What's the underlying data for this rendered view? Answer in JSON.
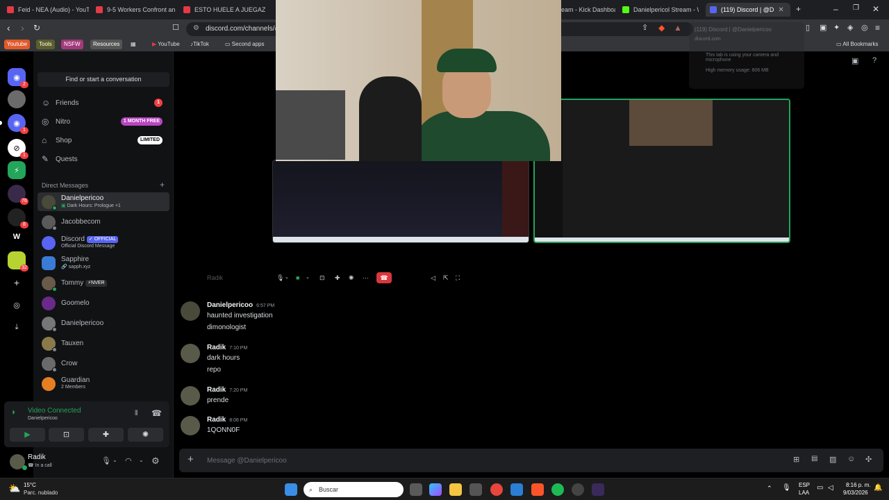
{
  "browser": {
    "tabs": [
      {
        "label": "Feid - NEA (Audio) - YouTu",
        "color": "#e63946"
      },
      {
        "label": "9-5 Workers Confront an",
        "color": "#e63946"
      },
      {
        "label": "ESTO HUELE A JUEGAZO !!",
        "color": "#e63946"
      },
      {
        "label": "eam - Kick Dashboa",
        "color": "#53fc18"
      },
      {
        "label": "Danielpericol Stream - Wa",
        "color": "#53fc18"
      },
      {
        "label": "(119) Discord | @D",
        "color": "#5865f2"
      }
    ],
    "url": "discord.com/channels/@",
    "bookmarks": [
      "Youtube",
      "Tools",
      "NSFW",
      "Resources",
      "YouTube",
      "TikTok",
      "Second apps",
      "All Bookmarks"
    ],
    "tooltip": {
      "title": "(119) Discord | @Danielpericoo",
      "domain": "discord.com",
      "camera": "This tab is using your camera and microphone",
      "memory": "High memory usage: 806 MB"
    }
  },
  "guilds": [
    {
      "icon": "discord-home",
      "badge": "2"
    },
    {
      "icon": "avatar",
      "badge": ""
    },
    {
      "icon": "discord",
      "badge": "1"
    },
    {
      "icon": "server",
      "badge": "1"
    },
    {
      "icon": "server",
      "badge": ""
    },
    {
      "icon": "server",
      "badge": "76"
    },
    {
      "icon": "server",
      "badge": "8"
    },
    {
      "icon": "W",
      "badge": ""
    },
    {
      "icon": "server",
      "badge": "32"
    }
  ],
  "sidebar": {
    "search_label": "Find or start a conversation",
    "nav": [
      {
        "label": "Friends",
        "badge": "1"
      },
      {
        "label": "Nitro",
        "badge": "1 MONTH FREE"
      },
      {
        "label": "Shop",
        "badge": "LIMITED"
      },
      {
        "label": "Quests",
        "badge": ""
      }
    ],
    "dm_header": "Direct Messages",
    "dms": [
      {
        "name": "Danielpericoo",
        "sub": "Dark Hours: Prologue +1"
      },
      {
        "name": "Jacobbecom",
        "sub": ""
      },
      {
        "name": "Discord",
        "tag": "OFFICIAL",
        "sub": "Official Discord Message"
      },
      {
        "name": "Sapphire",
        "sub": "sapph.xyz"
      },
      {
        "name": "Tommy",
        "tag": "NVER",
        "sub": ""
      },
      {
        "name": "Goomelo",
        "sub": ""
      },
      {
        "name": "Danielpericoo",
        "sub": ""
      },
      {
        "name": "Tauxen",
        "sub": ""
      },
      {
        "name": "Crow",
        "sub": ""
      },
      {
        "name": "Guardian",
        "sub": "2 Members"
      }
    ]
  },
  "voice": {
    "status": "Video Connected",
    "channel": "Danielpericoo"
  },
  "user": {
    "name": "Radik",
    "status": "In a call"
  },
  "call": {
    "name_label": "Radik"
  },
  "messages": [
    {
      "author": "Danielpericoo",
      "time": "6:57 PM",
      "lines": [
        "haunted investigation",
        "dimonologist"
      ]
    },
    {
      "author": "Radik",
      "time": "7:10 PM",
      "lines": [
        "dark hours",
        "repo"
      ]
    },
    {
      "author": "Radik",
      "time": "7:20 PM",
      "lines": [
        "prende"
      ]
    },
    {
      "author": "Radik",
      "time": "8:06 PM",
      "lines": [
        "1QONN0F"
      ]
    }
  ],
  "composer": {
    "placeholder": "Message @Danielpericoo"
  },
  "taskbar": {
    "weather_temp": "15°C",
    "weather_desc": "Parc. nublado",
    "search": "Buscar",
    "lang_top": "ESP",
    "lang_bottom": "LAA",
    "time": "8:16 p. m.",
    "date": "9/03/2026"
  }
}
